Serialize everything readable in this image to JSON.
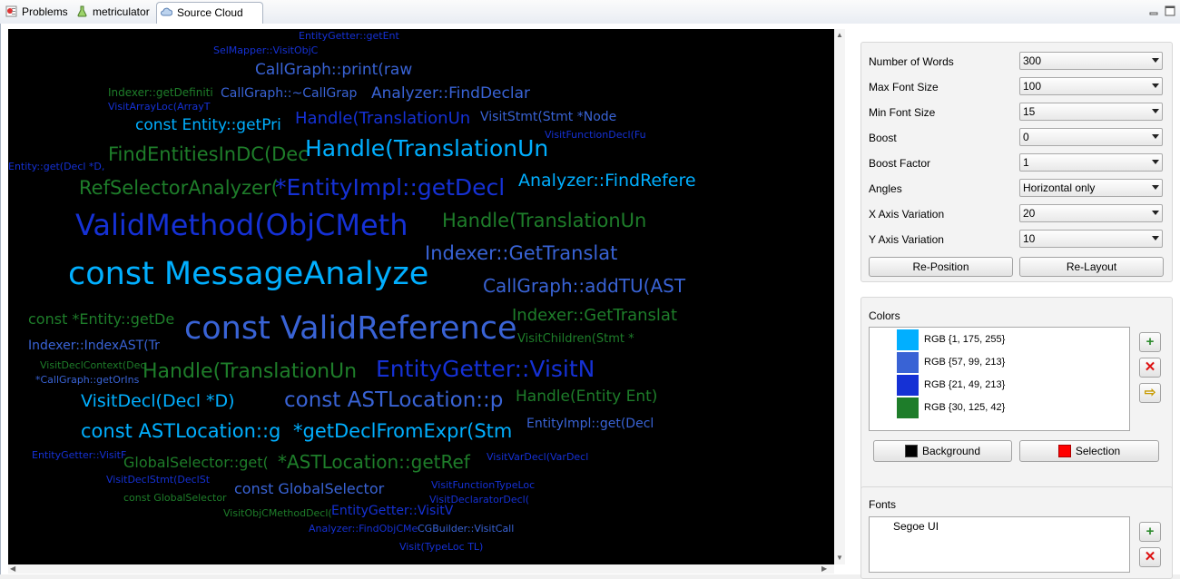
{
  "tabs": [
    {
      "label": "Problems",
      "icon": "problems-icon"
    },
    {
      "label": "metriculator",
      "icon": "flask-icon"
    },
    {
      "label": "Source Cloud",
      "icon": "cloud-icon",
      "active": true
    }
  ],
  "cloud": {
    "background": "#000000",
    "words": [
      {
        "t": "const MessageAnalyze",
        "c": "#01afff",
        "s": 35
      },
      {
        "t": "const ValidReference",
        "c": "#3963d5",
        "s": 35
      },
      {
        "t": "ValidMethod(ObjCMeth",
        "c": "#1531d5",
        "s": 32
      },
      {
        "t": "*EntityImpl::getDecl",
        "c": "#1531d5",
        "s": 25
      },
      {
        "t": "Handle(TranslationUn",
        "c": "#01afff",
        "s": 25
      },
      {
        "t": "EntityGetter::VisitN",
        "c": "#1531d5",
        "s": 25
      },
      {
        "t": "const ASTLocation::p",
        "c": "#3963d5",
        "s": 23
      },
      {
        "t": "*getDeclFromExpr(Stm",
        "c": "#01afff",
        "s": 21
      },
      {
        "t": "const ASTLocation::g",
        "c": "#01afff",
        "s": 21
      },
      {
        "t": "Handle(TranslationUn",
        "c": "#1e7d2a",
        "s": 22
      },
      {
        "t": "Handle(TranslationUn",
        "c": "#1e7d2a",
        "s": 21
      },
      {
        "t": "RefSelectorAnalyzer(",
        "c": "#1e7d2a",
        "s": 21
      },
      {
        "t": "FindEntitiesInDC(Dec",
        "c": "#1e7d2a",
        "s": 21
      },
      {
        "t": "Indexer::GetTranslat",
        "c": "#3963d5",
        "s": 21
      },
      {
        "t": "Indexer::GetTranslat",
        "c": "#1e7d2a",
        "s": 18
      },
      {
        "t": "CallGraph::addTU(AST",
        "c": "#3963d5",
        "s": 20
      },
      {
        "t": "*ASTLocation::getRef",
        "c": "#1e7d2a",
        "s": 20
      },
      {
        "t": "Analyzer::FindRefere",
        "c": "#01afff",
        "s": 19
      },
      {
        "t": "Handle(TranslationUn",
        "c": "#1531d5",
        "s": 18
      },
      {
        "t": "const Entity::getPri",
        "c": "#01afff",
        "s": 17
      },
      {
        "t": "Analyzer::FindDeclar",
        "c": "#3963d5",
        "s": 17
      },
      {
        "t": "CallGraph::print(raw",
        "c": "#3963d5",
        "s": 17
      },
      {
        "t": "const *Entity::getDe",
        "c": "#1e7d2a",
        "s": 16
      },
      {
        "t": "VisitDecl(Decl *D)",
        "c": "#01afff",
        "s": 19
      },
      {
        "t": "Handle(Entity Ent)",
        "c": "#1e7d2a",
        "s": 17
      },
      {
        "t": "GlobalSelector::get(",
        "c": "#1e7d2a",
        "s": 16
      },
      {
        "t": "const GlobalSelector",
        "c": "#3963d5",
        "s": 16
      },
      {
        "t": "Indexer::IndexAST(Tr",
        "c": "#3963d5",
        "s": 14
      },
      {
        "t": "EntityImpl::get(Decl",
        "c": "#3963d5",
        "s": 14
      },
      {
        "t": "EntityGetter::VisitV",
        "c": "#1531d5",
        "s": 14
      },
      {
        "t": "CallGraph::~CallGrap",
        "c": "#3963d5",
        "s": 14
      },
      {
        "t": "VisitStmt(Stmt *Node",
        "c": "#3963d5",
        "s": 14
      },
      {
        "t": "VisitChildren(Stmt *",
        "c": "#1e7d2a",
        "s": 13
      },
      {
        "t": "Indexer::getDefiniti",
        "c": "#1e7d2a",
        "s": 12
      },
      {
        "t": "VisitArrayLoc(ArrayT",
        "c": "#1531d5",
        "s": 11
      },
      {
        "t": "SelMapper::VisitObjC",
        "c": "#1531d5",
        "s": 11
      },
      {
        "t": "EntityGetter::getEnt",
        "c": "#1531d5",
        "s": 11
      },
      {
        "t": "VisitFunctionDecl(Fu",
        "c": "#1531d5",
        "s": 11
      },
      {
        "t": "Entity::get(Decl *D,",
        "c": "#1531d5",
        "s": 11
      },
      {
        "t": "VisitDeclContext(Dec",
        "c": "#1e7d2a",
        "s": 11
      },
      {
        "t": "*CallGraph::getOrIns",
        "c": "#3963d5",
        "s": 11
      },
      {
        "t": "EntityGetter::VisitF",
        "c": "#1531d5",
        "s": 11
      },
      {
        "t": "VisitDeclStmt(DeclSt",
        "c": "#1531d5",
        "s": 11
      },
      {
        "t": "const GlobalSelector",
        "c": "#1e7d2a",
        "s": 11
      },
      {
        "t": "VisitObjCMethodDecl(",
        "c": "#1e7d2a",
        "s": 11
      },
      {
        "t": "VisitFunctionTypeLoc",
        "c": "#1531d5",
        "s": 11
      },
      {
        "t": "VisitDeclaratorDecl(",
        "c": "#1531d5",
        "s": 11
      },
      {
        "t": "VisitVarDecl(VarDecl",
        "c": "#1531d5",
        "s": 11
      },
      {
        "t": "Analyzer::FindObjCMe",
        "c": "#1531d5",
        "s": 11
      },
      {
        "t": "CGBuilder::VisitCall",
        "c": "#3963d5",
        "s": 11
      },
      {
        "t": "Visit(TypeLoc TL)",
        "c": "#1531d5",
        "s": 11
      }
    ]
  },
  "settings": {
    "rows": [
      {
        "label": "Number of Words",
        "value": "300"
      },
      {
        "label": "Max Font Size",
        "value": "100"
      },
      {
        "label": "Min Font Size",
        "value": "15"
      },
      {
        "label": "Boost",
        "value": "0"
      },
      {
        "label": "Boost Factor",
        "value": "1"
      },
      {
        "label": "Angles",
        "value": "Horizontal only"
      },
      {
        "label": "X Axis Variation",
        "value": "20"
      },
      {
        "label": "Y Axis Variation",
        "value": "10"
      }
    ],
    "reposition_label": "Re-Position",
    "relayout_label": "Re-Layout"
  },
  "colors": {
    "title": "Colors",
    "items": [
      {
        "label": "RGB {1, 175, 255}",
        "hex": "#01afff"
      },
      {
        "label": "RGB {57, 99, 213}",
        "hex": "#3963d5"
      },
      {
        "label": "RGB {21, 49, 213}",
        "hex": "#1531d5"
      },
      {
        "label": "RGB {30, 125, 42}",
        "hex": "#1e7d2a"
      }
    ],
    "background_label": "Background",
    "background_hex": "#000000",
    "selection_label": "Selection",
    "selection_hex": "#ff0000"
  },
  "fonts": {
    "title": "Fonts",
    "items": [
      "Segoe UI"
    ]
  }
}
